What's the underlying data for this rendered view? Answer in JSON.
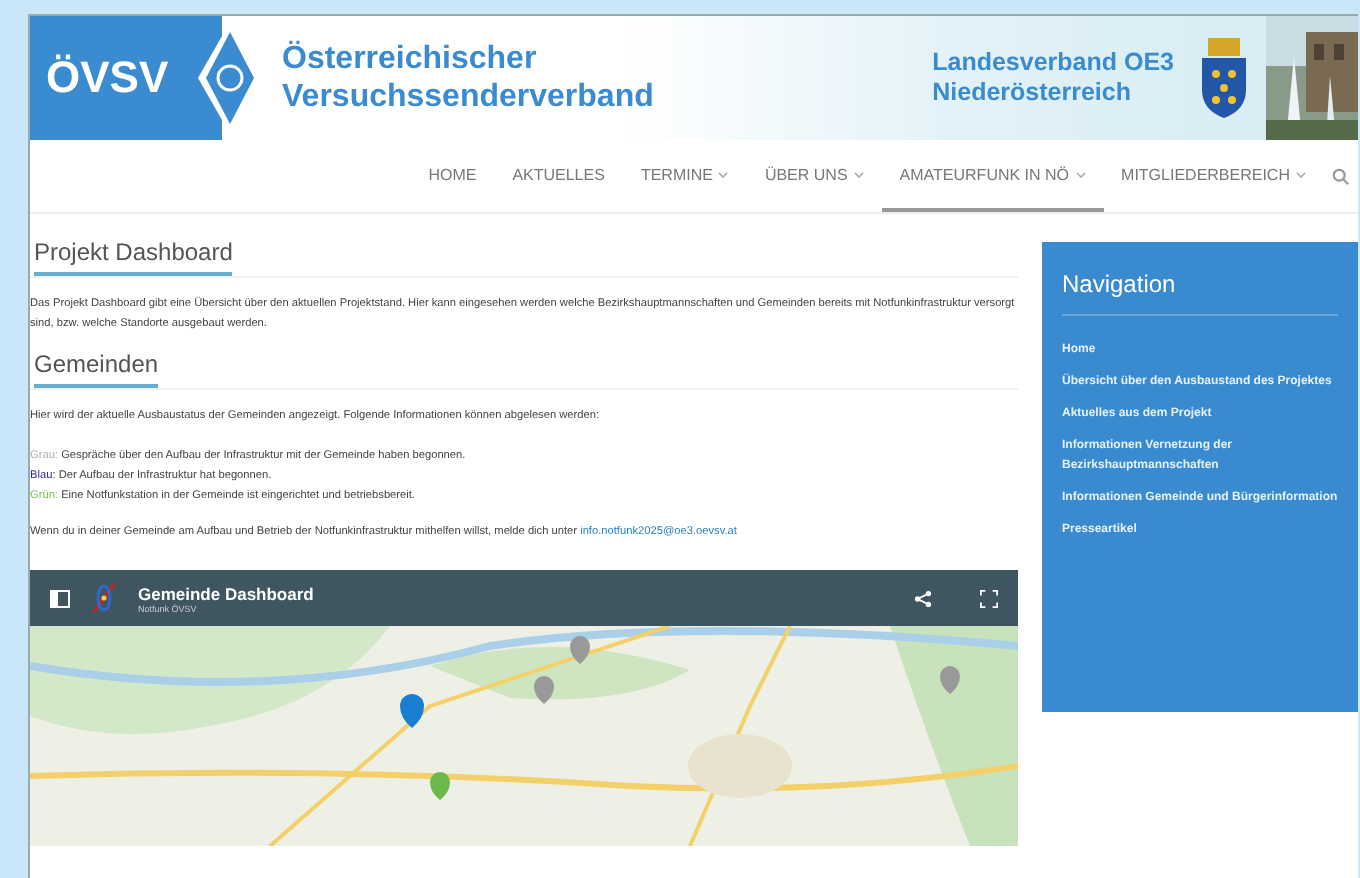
{
  "header": {
    "logo_text": "ÖVSV",
    "org_name": [
      "Österreichischer",
      "Versuchssenderverband"
    ],
    "region": [
      "Landesverband OE3",
      "Niederösterreich"
    ]
  },
  "nav": [
    {
      "label": "HOME",
      "dropdown": false,
      "selected": false
    },
    {
      "label": "AKTUELLES",
      "dropdown": false,
      "selected": false
    },
    {
      "label": "TERMINE",
      "dropdown": true,
      "selected": false
    },
    {
      "label": "ÜBER UNS",
      "dropdown": true,
      "selected": false
    },
    {
      "label": "AMATEURFUNK IN NÖ",
      "dropdown": true,
      "selected": true
    },
    {
      "label": "MITGLIEDERBEREICH",
      "dropdown": true,
      "selected": false
    }
  ],
  "main": {
    "title": "Projekt Dashboard",
    "intro": "Das Projekt Dashboard gibt eine Übersicht über den aktuellen Projektstand. Hier kann eingesehen werden welche Bezirkshauptmannschaften und Gemeinden bereits mit Notfunkinfrastruktur versorgt sind, bzw. welche Standorte ausgebaut werden.",
    "section_title": "Gemeinden",
    "section_intro": "Hier wird der aktuelle Ausbaustatus der Gemeinden angezeigt. Folgende Informationen können abgelesen werden:",
    "legend": [
      {
        "key": "Grau:",
        "text": "Gespräche über den Aufbau der Infrastruktur mit der Gemeinde haben begonnen.",
        "color": "#b0b0b0"
      },
      {
        "key": "Blau:",
        "text": "Der Aufbau der Infrastruktur hat begonnen.",
        "color": "#2a2aa8"
      },
      {
        "key": "Grün:",
        "text": "Eine Notfunkstation in der Gemeinde ist eingerichtet und betriebsbereit.",
        "color": "#7cc24a"
      }
    ],
    "help_text": "Wenn du in deiner Gemeinde am Aufbau und Betrieb der Notfunkinfrastruktur mithelfen willst, melde dich unter",
    "help_link": "info.notfunk2025@oe3.oevsv.at",
    "dashboard": {
      "title": "Gemeinde Dashboard",
      "subtitle": "Notfunk ÖVSV"
    }
  },
  "sidebar": {
    "title": "Navigation",
    "items": [
      "Home",
      "Übersicht über den Ausbaustand des Projektes",
      "Aktuelles aus dem Projekt",
      "Informationen Vernetzung der Bezirkshauptmannschaften",
      "Informationen Gemeinde und Bürgerinformation",
      "Presseartikel"
    ]
  }
}
